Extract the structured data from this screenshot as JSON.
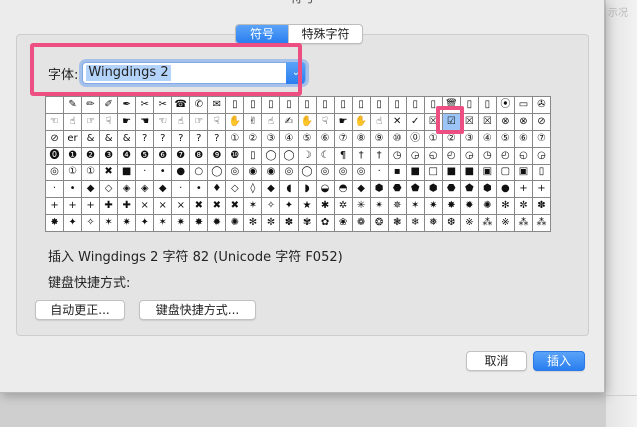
{
  "window": {
    "title": "符号"
  },
  "background": {
    "partial_text": "示况"
  },
  "tabs": [
    {
      "label": "符号",
      "active": true
    },
    {
      "label": "特殊字符",
      "active": false
    }
  ],
  "font": {
    "label": "字体:",
    "value": "Wingdings 2"
  },
  "symbol_grid": {
    "columns": 28,
    "selected_row": 1,
    "selected_col": 22,
    "rows": [
      [
        "",
        "✎",
        "✏",
        "✐",
        "✒",
        "✂",
        "✂",
        "☎",
        "✆",
        "✉",
        "▯",
        "▯",
        "▯",
        "▯",
        "▯",
        "▯",
        "▯",
        "▯",
        "▯",
        "▯",
        "▯",
        "▯",
        "🗑",
        "▯",
        "▯",
        "⦿",
        "▭",
        "✇"
      ],
      [
        "☜",
        "☝",
        "☞",
        "☟",
        "☛",
        "☚",
        "☜",
        "☝",
        "☞",
        "☟",
        "✋",
        "✌",
        "☝",
        "✍",
        "✋",
        "☟",
        "☛",
        "✋",
        "☝",
        "✕",
        "✓",
        "☒",
        "☑",
        "☒",
        "☒",
        "⊗",
        "⊗",
        "⊘"
      ],
      [
        "⊘",
        "er",
        "&",
        "&",
        "&",
        "?",
        "?",
        "?",
        "?",
        "?",
        "①",
        "②",
        "③",
        "④",
        "⑤",
        "⑥",
        "⑦",
        "⑧",
        "⑨",
        "⑩",
        "⓪",
        "①",
        "②",
        "③",
        "④",
        "⑤",
        "⑥",
        "⑦"
      ],
      [
        "⓿",
        "❶",
        "❷",
        "❸",
        "❹",
        "❺",
        "❻",
        "❼",
        "❽",
        "❾",
        "❿",
        "▯",
        "◯",
        "◯",
        "☽",
        "☾",
        "¶",
        "†",
        "†",
        "◷",
        "◶",
        "◵",
        "◴",
        "◶",
        "◷",
        "◴",
        "◵",
        "◶"
      ],
      [
        "◎",
        "①",
        "①",
        "✖",
        "■",
        "·",
        "•",
        "●",
        "○",
        "◯",
        "◎",
        "◉",
        "◉",
        "◎",
        "◯",
        "◎",
        "◎",
        "◎",
        "·",
        "▪",
        "■",
        "□",
        "■",
        "■",
        "▣",
        "▢",
        "▣",
        "▯"
      ],
      [
        "·",
        "•",
        "◆",
        "◇",
        "◈",
        "◈",
        "◆",
        "·",
        "•",
        "♦",
        "◇",
        "◊",
        "◆",
        "◖",
        "◗",
        "◒",
        "◓",
        "◆",
        "⬢",
        "⬣",
        "⬟",
        "⬢",
        "⬣",
        "⬟",
        "⬢",
        "●",
        "+",
        "+"
      ],
      [
        "+",
        "+",
        "+",
        "✚",
        "✚",
        "×",
        "×",
        "×",
        "✖",
        "✖",
        "✖",
        "✶",
        "✧",
        "✦",
        "★",
        "✱",
        "✲",
        "✳",
        "✴",
        "✵",
        "✶",
        "✷",
        "✸",
        "✹",
        "✺",
        "✻",
        "✼",
        "✽"
      ],
      [
        "✸",
        "✦",
        "✧",
        "✶",
        "✷",
        "✦",
        "✶",
        "✷",
        "✸",
        "✹",
        "✺",
        "✻",
        "✼",
        "✽",
        "✾",
        "✿",
        "❀",
        "❁",
        "❂",
        "❃",
        "❄",
        "❅",
        "❆",
        "※",
        "⁂",
        "※",
        "⁂",
        "⁂"
      ]
    ]
  },
  "info": {
    "text": "插入 Wingdings 2 字符 82 (Unicode 字符 F052)"
  },
  "shortcut": {
    "label": "键盘快捷方式:"
  },
  "buttons": {
    "autocorrect": "自动更正...",
    "keyboard_shortcut": "键盘快捷方式...",
    "cancel": "取消",
    "insert": "插入"
  },
  "colors": {
    "accent": "#2a7ef0",
    "annotation": "#ee4f83",
    "selection": "#9cc5f7"
  }
}
